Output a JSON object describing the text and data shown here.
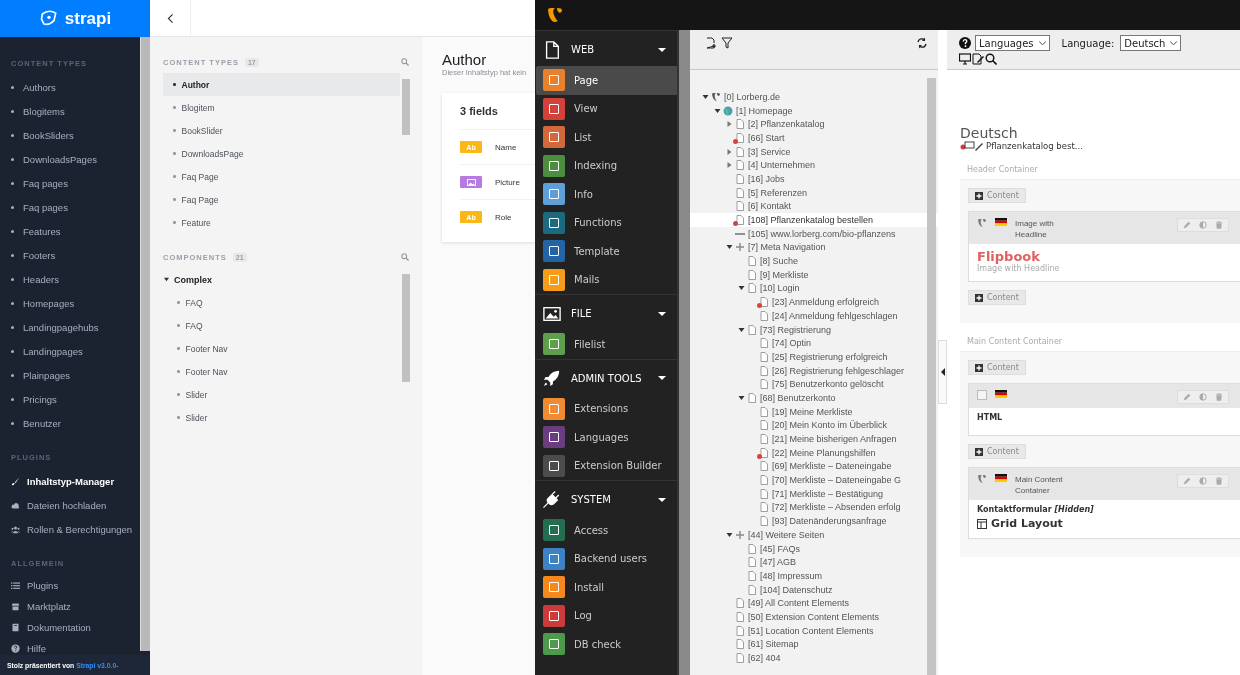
{
  "strapi": {
    "logo": "strapi",
    "sidebar": [
      {
        "title": "CONTENT TYPES",
        "kind": "bullets",
        "items": [
          {
            "label": "Authors",
            "selected": false
          },
          {
            "label": "Blogitems",
            "selected": false
          },
          {
            "label": "BookSliders",
            "selected": false
          },
          {
            "label": "DownloadsPages",
            "selected": false
          },
          {
            "label": "Faq pages",
            "selected": false
          },
          {
            "label": "Faq pages",
            "selected": false
          },
          {
            "label": "Features",
            "selected": false
          },
          {
            "label": "Footers",
            "selected": false
          },
          {
            "label": "Headers",
            "selected": false
          },
          {
            "label": "Homepages",
            "selected": false
          },
          {
            "label": "Landingpagehubs",
            "selected": false
          },
          {
            "label": "Landingpages",
            "selected": false
          },
          {
            "label": "Plainpages",
            "selected": false
          },
          {
            "label": "Pricings",
            "selected": false
          },
          {
            "label": "Benutzer",
            "selected": false
          }
        ]
      },
      {
        "title": "PLUGINS",
        "kind": "icons",
        "items": [
          {
            "label": "Inhaltstyp-Manager",
            "selected": true
          },
          {
            "label": "Dateien hochladen",
            "selected": false
          },
          {
            "label": "Rollen & Berechtigungen",
            "selected": false
          }
        ]
      },
      {
        "title": "ALLGEMEIN",
        "kind": "icons",
        "items": [
          {
            "label": "Plugins",
            "selected": false
          },
          {
            "label": "Marktplatz",
            "selected": false
          },
          {
            "label": "Dokumentation",
            "selected": false
          },
          {
            "label": "Hilfe",
            "selected": false
          }
        ]
      }
    ],
    "footer": {
      "text": "Stolz präsentiert von",
      "link": "Strapi v3.0.0-"
    },
    "content_types": {
      "title": "CONTENT TYPES",
      "count": "17",
      "items": [
        {
          "label": "Author",
          "selected": true
        },
        {
          "label": "Blogitem",
          "selected": false
        },
        {
          "label": "BookSlider",
          "selected": false
        },
        {
          "label": "DownloadsPage",
          "selected": false
        },
        {
          "label": "Faq Page",
          "selected": false
        },
        {
          "label": "Faq Page",
          "selected": false
        },
        {
          "label": "Feature",
          "selected": false
        }
      ]
    },
    "components": {
      "title": "COMPONENTS",
      "count": "21",
      "groups": [
        {
          "label": "Complex",
          "expanded": true,
          "children": [
            "FAQ",
            "FAQ",
            "Footer Nav",
            "Footer Nav",
            "Slider",
            "Slider"
          ]
        }
      ]
    },
    "detail": {
      "title": "Author",
      "subtitle": "Dieser Inhaltstyp hat kein",
      "fields_title": "3 fields",
      "fields": [
        {
          "kind": "text",
          "badge": "Ab",
          "name": "Name"
        },
        {
          "kind": "media",
          "name": "Picture"
        },
        {
          "kind": "text",
          "badge": "Ab",
          "name": "Role"
        }
      ]
    }
  },
  "typo3": {
    "modules": [
      {
        "title": "WEB",
        "expanded": true,
        "items": [
          {
            "label": "Page",
            "color": "#e8812e",
            "selected": true
          },
          {
            "label": "View",
            "color": "#d3413a",
            "selected": false
          },
          {
            "label": "List",
            "color": "#d2683b",
            "selected": false
          },
          {
            "label": "Indexing",
            "color": "#4d8d3f",
            "selected": false
          },
          {
            "label": "Info",
            "color": "#5e9fd8",
            "selected": false
          },
          {
            "label": "Functions",
            "color": "#1b6a80",
            "selected": false
          },
          {
            "label": "Template",
            "color": "#2364a7",
            "selected": false
          },
          {
            "label": "Mails",
            "color": "#f59c1a",
            "selected": false
          }
        ]
      },
      {
        "title": "FILE",
        "expanded": true,
        "items": [
          {
            "label": "Filelist",
            "color": "#5d9f4b",
            "selected": false
          }
        ]
      },
      {
        "title": "ADMIN TOOLS",
        "expanded": true,
        "items": [
          {
            "label": "Extensions",
            "color": "#f08b34",
            "selected": false
          },
          {
            "label": "Languages",
            "color": "#6b3c80",
            "selected": false
          },
          {
            "label": "Extension Builder",
            "color": "#4c4c4c",
            "selected": false
          }
        ]
      },
      {
        "title": "SYSTEM",
        "expanded": true,
        "items": [
          {
            "label": "Access",
            "color": "#246d50",
            "selected": false
          },
          {
            "label": "Backend users",
            "color": "#3c82c5",
            "selected": false
          },
          {
            "label": "Install",
            "color": "#f7881e",
            "selected": false
          },
          {
            "label": "Log",
            "color": "#cb3b3b",
            "selected": false
          },
          {
            "label": "DB check",
            "color": "#4d9a4d",
            "selected": false
          }
        ]
      }
    ],
    "tree": [
      {
        "label": "[0] Lorberg.de",
        "kind": "root",
        "hidden": false,
        "selected": false,
        "expanded": true,
        "children": [
          {
            "label": "[1] Homepage",
            "kind": "site",
            "hidden": false,
            "selected": false,
            "expanded": true,
            "children": [
              {
                "label": "[2] Pflanzenkatalog",
                "kind": "page",
                "hidden": false,
                "selected": false,
                "expanded": false
              },
              {
                "label": "[66] Start",
                "kind": "page",
                "hidden": true,
                "selected": false
              },
              {
                "label": "[3] Service",
                "kind": "page",
                "hidden": false,
                "selected": false,
                "expanded": false
              },
              {
                "label": "[4] Unternehmen",
                "kind": "page",
                "hidden": false,
                "selected": false,
                "expanded": false
              },
              {
                "label": "[16] Jobs",
                "kind": "page",
                "hidden": false,
                "selected": false
              },
              {
                "label": "[5] Referenzen",
                "kind": "page",
                "hidden": false,
                "selected": false
              },
              {
                "label": "[6] Kontakt",
                "kind": "page",
                "hidden": false,
                "selected": false
              },
              {
                "label": "[108] Pflanzenkatalog bestellen",
                "kind": "page",
                "hidden": true,
                "selected": true
              },
              {
                "label": "[105] www.lorberg.com/bio-pflanzens",
                "kind": "link",
                "hidden": false,
                "selected": false
              },
              {
                "label": "[7] Meta Navigation",
                "kind": "menu",
                "hidden": false,
                "selected": false,
                "expanded": true,
                "children": [
                  {
                    "label": "[8] Suche",
                    "kind": "page",
                    "hidden": false,
                    "selected": false
                  },
                  {
                    "label": "[9] Merkliste",
                    "kind": "page",
                    "hidden": false,
                    "selected": false
                  },
                  {
                    "label": "[10] Login",
                    "kind": "page",
                    "hidden": false,
                    "selected": false,
                    "expanded": true,
                    "children": [
                      {
                        "label": "[23] Anmeldung erfolgreich",
                        "kind": "page",
                        "hidden": true,
                        "selected": false
                      },
                      {
                        "label": "[24] Anmeldung fehlgeschlagen",
                        "kind": "page",
                        "hidden": false,
                        "selected": false
                      }
                    ]
                  },
                  {
                    "label": "[73] Registrierung",
                    "kind": "page",
                    "hidden": false,
                    "selected": false,
                    "expanded": true,
                    "children": [
                      {
                        "label": "[74] Optin",
                        "kind": "page",
                        "hidden": false,
                        "selected": false
                      },
                      {
                        "label": "[25] Registrierung erfolgreich",
                        "kind": "page",
                        "hidden": false,
                        "selected": false
                      },
                      {
                        "label": "[26] Registrierung fehlgeschlager",
                        "kind": "page",
                        "hidden": false,
                        "selected": false
                      },
                      {
                        "label": "[75] Benutzerkonto gelöscht",
                        "kind": "page",
                        "hidden": false,
                        "selected": false
                      }
                    ]
                  },
                  {
                    "label": "[68] Benutzerkonto",
                    "kind": "page",
                    "hidden": false,
                    "selected": false,
                    "expanded": true,
                    "children": [
                      {
                        "label": "[19] Meine Merkliste",
                        "kind": "page",
                        "hidden": false,
                        "selected": false
                      },
                      {
                        "label": "[20] Mein Konto im Überblick",
                        "kind": "page",
                        "hidden": false,
                        "selected": false
                      },
                      {
                        "label": "[21] Meine bisherigen Anfragen",
                        "kind": "page",
                        "hidden": false,
                        "selected": false
                      },
                      {
                        "label": "[22] Meine Planungshilfen",
                        "kind": "page",
                        "hidden": true,
                        "selected": false
                      },
                      {
                        "label": "[69] Merkliste – Dateneingabe",
                        "kind": "page",
                        "hidden": false,
                        "selected": false
                      },
                      {
                        "label": "[70] Merkliste – Dateneingabe G",
                        "kind": "page",
                        "hidden": false,
                        "selected": false
                      },
                      {
                        "label": "[71] Merkliste – Bestätigung",
                        "kind": "page",
                        "hidden": false,
                        "selected": false
                      },
                      {
                        "label": "[72] Merkliste – Absenden erfolg",
                        "kind": "page",
                        "hidden": false,
                        "selected": false
                      },
                      {
                        "label": "[93] Datenänderungsanfrage",
                        "kind": "page",
                        "hidden": false,
                        "selected": false
                      }
                    ]
                  }
                ]
              },
              {
                "label": "[44] Weitere Seiten",
                "kind": "menu",
                "hidden": false,
                "selected": false,
                "expanded": true,
                "children": [
                  {
                    "label": "[45] FAQs",
                    "kind": "page",
                    "hidden": false,
                    "selected": false
                  },
                  {
                    "label": "[47] AGB",
                    "kind": "page",
                    "hidden": false,
                    "selected": false
                  },
                  {
                    "label": "[48] Impressum",
                    "kind": "page",
                    "hidden": false,
                    "selected": false
                  },
                  {
                    "label": "[104] Datenschutz",
                    "kind": "page",
                    "hidden": false,
                    "selected": false
                  }
                ]
              },
              {
                "label": "[49] All Content Elements",
                "kind": "page",
                "hidden": false,
                "selected": false
              },
              {
                "label": "[50] Extension Content Elements",
                "kind": "page",
                "hidden": false,
                "selected": false
              },
              {
                "label": "[51] Location Content Elements",
                "kind": "page",
                "hidden": false,
                "selected": false
              },
              {
                "label": "[61] Sitemap",
                "kind": "page",
                "hidden": false,
                "selected": false
              },
              {
                "label": "[62] 404",
                "kind": "page",
                "hidden": false,
                "selected": false
              }
            ]
          }
        ]
      }
    ],
    "toolbar": {
      "view_select": "Languages",
      "language_label": "Language:",
      "language_select": "Deutsch"
    },
    "page": {
      "language_heading": "Deutsch",
      "page_title": "Pflanzenkatalog best...",
      "containers": [
        {
          "title": "Header Container",
          "items": [
            {
              "kind": "add",
              "label": "Content"
            },
            {
              "kind": "element",
              "type_label": "Image with Headline",
              "header": "Flipbook",
              "subheader": "Image with Headline"
            },
            {
              "kind": "add",
              "label": "Content"
            }
          ]
        },
        {
          "title": "Main Content Container",
          "items": [
            {
              "kind": "add",
              "label": "Content"
            },
            {
              "kind": "element",
              "body": "HTML"
            },
            {
              "kind": "add",
              "label": "Content"
            },
            {
              "kind": "element",
              "type_label": "Main Content Container",
              "body": "Kontaktformular *[Hidden]*",
              "layout": "Grid Layout"
            }
          ]
        }
      ]
    }
  }
}
